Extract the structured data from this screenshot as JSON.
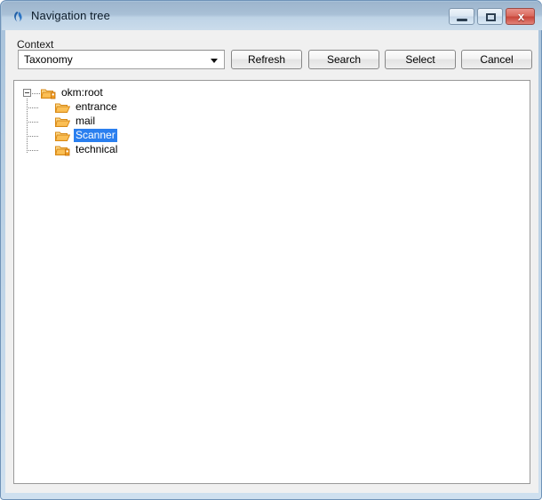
{
  "window": {
    "title": "Navigation tree",
    "app_icon": "java-icon",
    "controls": {
      "minimize": "minimize-icon",
      "maximize": "maximize-icon",
      "close_label": "x"
    }
  },
  "form": {
    "context_label": "Context",
    "context_value": "Taxonomy",
    "dropdown_icon": "chevron-down-icon"
  },
  "buttons": {
    "refresh": "Refresh",
    "search": "Search",
    "select": "Select",
    "cancel": "Cancel"
  },
  "tree": {
    "root": {
      "label": "okm:root",
      "icon": "folder-locked-icon",
      "expanded": true,
      "expander_icon": "collapse-minus-icon"
    },
    "children": [
      {
        "label": "entrance",
        "icon": "folder-open-icon",
        "selected": false
      },
      {
        "label": "mail",
        "icon": "folder-open-icon",
        "selected": false
      },
      {
        "label": "Scanner",
        "icon": "folder-open-icon",
        "selected": true
      },
      {
        "label": "technical",
        "icon": "folder-locked-icon",
        "selected": false
      }
    ]
  },
  "colors": {
    "selection": "#2a7fef",
    "folder": "#f0a830",
    "titlebar_top": "#9db5cd",
    "titlebar_bottom": "#cbdceb",
    "close_button": "#c8453a"
  }
}
